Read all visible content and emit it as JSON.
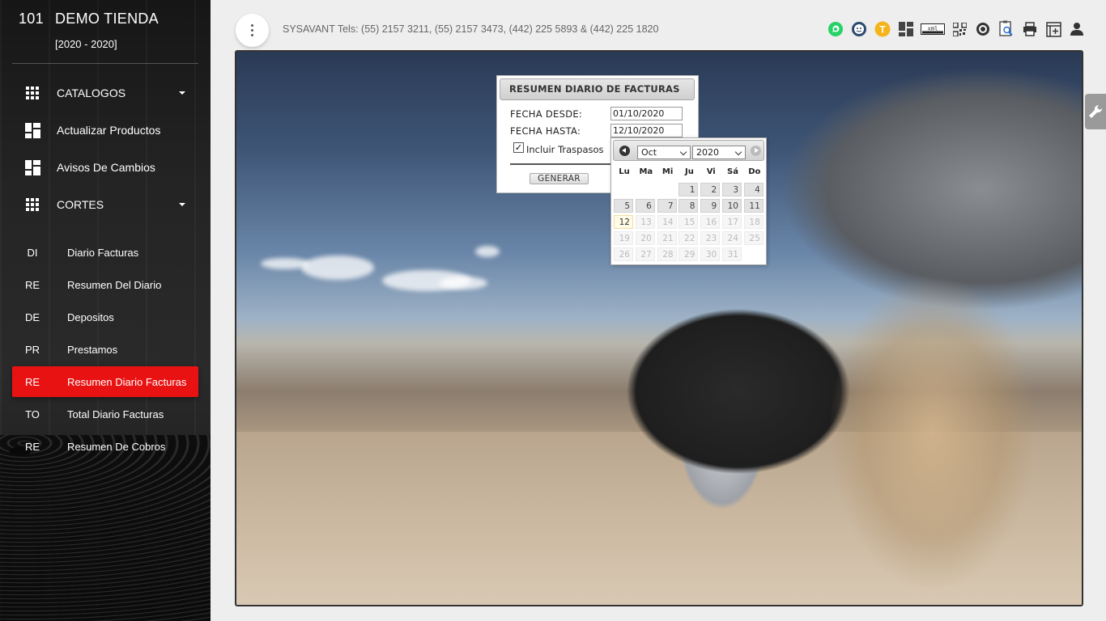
{
  "sidebar": {
    "store_number": "101",
    "store_name": "DEMO TIENDA",
    "years": "[2020 - 2020]",
    "menu": [
      {
        "label": "CATALOGOS",
        "icon": "grid-icon",
        "has_caret": true
      },
      {
        "label": "Actualizar Productos",
        "icon": "dashboard-icon"
      },
      {
        "label": "Avisos De Cambios",
        "icon": "dashboard-icon"
      },
      {
        "label": "CORTES",
        "icon": "grid-icon",
        "has_caret": true
      }
    ],
    "sub_items": [
      {
        "abbr": "DI",
        "label": "Diario Facturas"
      },
      {
        "abbr": "RE",
        "label": "Resumen Del Diario"
      },
      {
        "abbr": "DE",
        "label": "Depositos"
      },
      {
        "abbr": "PR",
        "label": "Prestamos"
      },
      {
        "abbr": "RE",
        "label": "Resumen Diario Facturas",
        "active": true
      },
      {
        "abbr": "TO",
        "label": "Total Diario Facturas"
      },
      {
        "abbr": "RE",
        "label": "Resumen De Cobros"
      }
    ],
    "active_color": "#e91212"
  },
  "topbar": {
    "contact": "SYSAVANT Tels: (55) 2157 3211, (55) 2157 3473, (442) 225 5893 & (442) 225 1820",
    "icons": [
      "whatsapp-icon",
      "support-agent-icon",
      "t-badge-icon",
      "dashboard-icon",
      "xml-icon",
      "qr-code-icon",
      "settings-wheel-icon",
      "search-document-icon",
      "print-icon",
      "add-window-icon",
      "user-icon"
    ],
    "t_badge_letter": "T",
    "xml_text": "xml"
  },
  "dialog": {
    "title": "RESUMEN DIARIO DE FACTURAS",
    "fecha_desde_label": "FECHA DESDE:",
    "fecha_desde_value": "01/10/2020",
    "fecha_hasta_label": "FECHA HASTA:",
    "fecha_hasta_value": "12/10/2020",
    "incluir_traspasos_label": "Incluir Traspasos",
    "incluir_traspasos_checked": true,
    "generate_label": "GENERAR"
  },
  "datepicker": {
    "month": "Oct",
    "year": "2020",
    "days_of_week": [
      "Lu",
      "Ma",
      "Mi",
      "Ju",
      "Vi",
      "Sá",
      "Do"
    ],
    "first_weekday_index": 3,
    "days_in_month": 31,
    "selected_day": 12,
    "last_enabled_day": 11
  }
}
